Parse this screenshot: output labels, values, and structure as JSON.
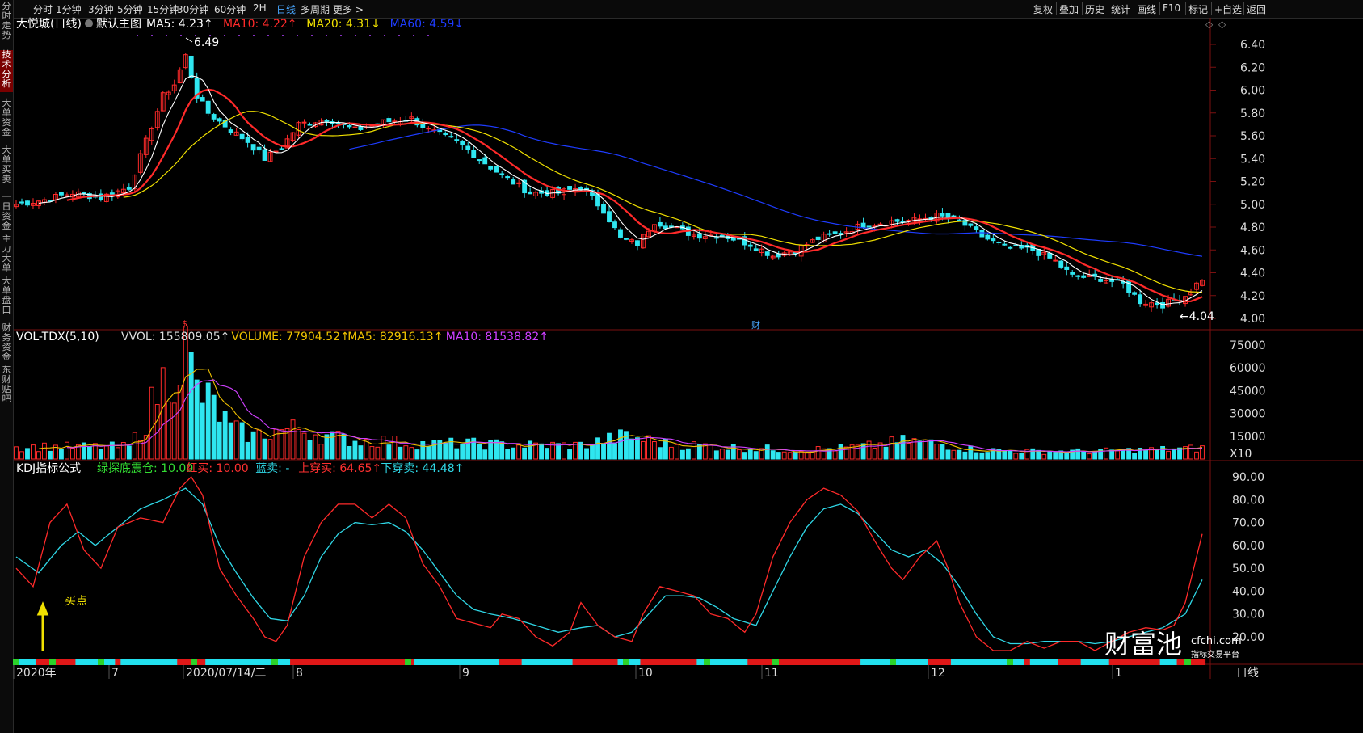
{
  "left_rail": [
    {
      "label": "分时走势",
      "active": false
    },
    {
      "label": "技术分析",
      "active": true
    },
    {
      "label": "大单资金",
      "active": false
    },
    {
      "label": "大单买卖",
      "active": false
    },
    {
      "label": "一日资金",
      "active": false
    },
    {
      "label": "主力大单",
      "active": false
    },
    {
      "label": "大单盘口",
      "active": false
    },
    {
      "label": "财务资金",
      "active": false
    },
    {
      "label": "东财贴吧",
      "active": false
    }
  ],
  "toolbar": {
    "periods": [
      "分时",
      "1分钟",
      "3分钟",
      "5分钟",
      "15分钟",
      "30分钟",
      "60分钟",
      "2H",
      "日线",
      "多周期",
      "更多 >"
    ],
    "active_period": "日线",
    "tools": [
      "复权",
      "叠加",
      "历史",
      "统计",
      "画线",
      "F10",
      "标记",
      "+自选",
      "返回"
    ]
  },
  "main_panel": {
    "stock_name": "大悦城(日线)",
    "template": "默认主图",
    "indicators": [
      {
        "label": "MA5: 4.23↑",
        "color": "#ffffff"
      },
      {
        "label": "MA10: 4.22↑",
        "color": "#ff2a2a"
      },
      {
        "label": "MA20: 4.31↓",
        "color": "#f0e000"
      },
      {
        "label": "MA60: 4.59↓",
        "color": "#1e3cff"
      }
    ],
    "price_ticks": [
      "6.40",
      "6.20",
      "6.00",
      "5.80",
      "5.60",
      "5.40",
      "5.20",
      "5.00",
      "4.80",
      "4.60",
      "4.40",
      "4.20",
      "4.00"
    ],
    "high_label": "6.49",
    "low_label": "4.04",
    "markers": [
      "$",
      "财"
    ]
  },
  "vol_panel": {
    "title": "VOL-TDX(5,10)",
    "indicators": [
      {
        "label": "VVOL: 155809.05↑",
        "color": "#dddddd"
      },
      {
        "label": "VOLUME: 77904.52↑",
        "color": "#f0c000"
      },
      {
        "label": "MA5: 82916.13↑",
        "color": "#f0c000"
      },
      {
        "label": "MA10: 81538.82↑",
        "color": "#d040ff"
      }
    ],
    "ticks": [
      "75000",
      "60000",
      "45000",
      "30000",
      "15000"
    ],
    "unit": "X10"
  },
  "kdj_panel": {
    "title": "KDJ指标公式",
    "indicators": [
      {
        "label": "绿探底震仓: 10.00",
        "color": "#33dd33"
      },
      {
        "label": "红买: 10.00",
        "color": "#ff3030"
      },
      {
        "label": "蓝卖: -",
        "color": "#2fd7e6"
      },
      {
        "label": "上穿买: 64.65↑",
        "color": "#ff3030"
      },
      {
        "label": "下穿卖: 44.48↑",
        "color": "#2fd7e6"
      }
    ],
    "ticks": [
      "90.00",
      "80.00",
      "70.00",
      "60.00",
      "50.00",
      "40.00",
      "30.00",
      "20.00"
    ],
    "buy_label": "买点"
  },
  "x_axis": {
    "labels": [
      "2020年",
      "7",
      "2020/07/14/二",
      "8",
      "9",
      "10",
      "11",
      "12",
      "1"
    ],
    "period_label": "日线"
  },
  "watermark": {
    "brand": "财富池",
    "site": "cfchi.com",
    "slogan": "指标交易平台"
  },
  "colors": {
    "up": "#ff2a2a",
    "down": "#2fe6f0",
    "ma5": "#ffffff",
    "ma10": "#ff2a2a",
    "ma20": "#f0e000",
    "ma60": "#1e3cff",
    "k": "#ff2a2a",
    "d": "#2fd7e6"
  },
  "chart_data": {
    "type": "candlestick",
    "title": "大悦城(日线)",
    "ylim": [
      4.0,
      6.5
    ],
    "x_months": [
      "2020年",
      "7",
      "8",
      "9",
      "10",
      "11",
      "12",
      "1"
    ],
    "anchor_close": [
      [
        0,
        5.0
      ],
      [
        5,
        5.04
      ],
      [
        10,
        5.1
      ],
      [
        15,
        5.06
      ],
      [
        20,
        5.15
      ],
      [
        23,
        5.55
      ],
      [
        26,
        5.95
      ],
      [
        28,
        6.05
      ],
      [
        30,
        6.3
      ],
      [
        32,
        5.95
      ],
      [
        34,
        5.8
      ],
      [
        38,
        5.65
      ],
      [
        41,
        5.55
      ],
      [
        44,
        5.4
      ],
      [
        47,
        5.5
      ],
      [
        50,
        5.7
      ],
      [
        55,
        5.75
      ],
      [
        60,
        5.65
      ],
      [
        65,
        5.72
      ],
      [
        70,
        5.75
      ],
      [
        73,
        5.65
      ],
      [
        78,
        5.55
      ],
      [
        82,
        5.4
      ],
      [
        86,
        5.25
      ],
      [
        91,
        5.1
      ],
      [
        96,
        5.1
      ],
      [
        100,
        5.15
      ],
      [
        104,
        4.95
      ],
      [
        107,
        4.7
      ],
      [
        110,
        4.65
      ],
      [
        113,
        4.85
      ],
      [
        116,
        4.8
      ],
      [
        120,
        4.73
      ],
      [
        125,
        4.73
      ],
      [
        130,
        4.65
      ],
      [
        134,
        4.55
      ],
      [
        138,
        4.6
      ],
      [
        142,
        4.7
      ],
      [
        146,
        4.75
      ],
      [
        150,
        4.82
      ],
      [
        155,
        4.85
      ],
      [
        159,
        4.86
      ],
      [
        163,
        4.9
      ],
      [
        167,
        4.85
      ],
      [
        171,
        4.72
      ],
      [
        175,
        4.62
      ],
      [
        180,
        4.6
      ],
      [
        184,
        4.5
      ],
      [
        187,
        4.37
      ],
      [
        192,
        4.35
      ],
      [
        196,
        4.3
      ],
      [
        199,
        4.15
      ],
      [
        203,
        4.12
      ],
      [
        207,
        4.2
      ],
      [
        210,
        4.35
      ]
    ],
    "volume_k": [
      [
        0,
        8
      ],
      [
        10,
        8
      ],
      [
        20,
        8
      ],
      [
        23,
        25
      ],
      [
        25,
        45
      ],
      [
        28,
        60
      ],
      [
        30,
        72
      ],
      [
        32,
        45
      ],
      [
        35,
        35
      ],
      [
        38,
        20
      ],
      [
        42,
        15
      ],
      [
        45,
        18
      ],
      [
        50,
        20
      ],
      [
        55,
        15
      ],
      [
        60,
        12
      ],
      [
        65,
        12
      ],
      [
        70,
        10
      ],
      [
        80,
        10
      ],
      [
        90,
        9
      ],
      [
        100,
        9
      ],
      [
        104,
        12
      ],
      [
        108,
        15
      ],
      [
        115,
        10
      ],
      [
        130,
        7
      ],
      [
        140,
        6
      ],
      [
        150,
        8
      ],
      [
        158,
        12
      ],
      [
        163,
        10
      ],
      [
        170,
        6
      ],
      [
        180,
        5
      ],
      [
        190,
        5
      ],
      [
        200,
        6
      ],
      [
        210,
        7
      ]
    ],
    "kdj_k": [
      [
        0,
        50
      ],
      [
        3,
        42
      ],
      [
        6,
        70
      ],
      [
        9,
        78
      ],
      [
        12,
        58
      ],
      [
        15,
        50
      ],
      [
        18,
        68
      ],
      [
        22,
        72
      ],
      [
        26,
        70
      ],
      [
        29,
        85
      ],
      [
        31,
        90
      ],
      [
        33,
        82
      ],
      [
        36,
        50
      ],
      [
        39,
        38
      ],
      [
        42,
        28
      ],
      [
        44,
        20
      ],
      [
        46,
        18
      ],
      [
        48,
        25
      ],
      [
        51,
        55
      ],
      [
        54,
        70
      ],
      [
        57,
        78
      ],
      [
        60,
        78
      ],
      [
        63,
        72
      ],
      [
        66,
        78
      ],
      [
        69,
        72
      ],
      [
        72,
        52
      ],
      [
        75,
        42
      ],
      [
        78,
        28
      ],
      [
        81,
        26
      ],
      [
        84,
        24
      ],
      [
        86,
        30
      ],
      [
        89,
        28
      ],
      [
        92,
        20
      ],
      [
        95,
        16
      ],
      [
        98,
        22
      ],
      [
        100,
        35
      ],
      [
        103,
        25
      ],
      [
        106,
        20
      ],
      [
        109,
        18
      ],
      [
        111,
        30
      ],
      [
        114,
        42
      ],
      [
        117,
        40
      ],
      [
        120,
        38
      ],
      [
        123,
        30
      ],
      [
        126,
        28
      ],
      [
        129,
        22
      ],
      [
        131,
        30
      ],
      [
        134,
        55
      ],
      [
        137,
        70
      ],
      [
        140,
        80
      ],
      [
        143,
        85
      ],
      [
        146,
        82
      ],
      [
        149,
        75
      ],
      [
        152,
        62
      ],
      [
        155,
        50
      ],
      [
        157,
        45
      ],
      [
        160,
        55
      ],
      [
        163,
        62
      ],
      [
        165,
        50
      ],
      [
        167,
        35
      ],
      [
        170,
        20
      ],
      [
        173,
        14
      ],
      [
        176,
        14
      ],
      [
        179,
        18
      ],
      [
        182,
        15
      ],
      [
        185,
        18
      ],
      [
        188,
        18
      ],
      [
        191,
        14
      ],
      [
        194,
        18
      ],
      [
        197,
        22
      ],
      [
        200,
        24
      ],
      [
        203,
        23
      ],
      [
        205,
        25
      ],
      [
        207,
        35
      ],
      [
        210,
        65
      ]
    ],
    "kdj_d": [
      [
        0,
        55
      ],
      [
        4,
        48
      ],
      [
        8,
        60
      ],
      [
        11,
        66
      ],
      [
        14,
        60
      ],
      [
        18,
        68
      ],
      [
        22,
        76
      ],
      [
        26,
        80
      ],
      [
        30,
        85
      ],
      [
        33,
        78
      ],
      [
        36,
        60
      ],
      [
        39,
        48
      ],
      [
        42,
        37
      ],
      [
        45,
        28
      ],
      [
        48,
        27
      ],
      [
        51,
        38
      ],
      [
        54,
        55
      ],
      [
        57,
        65
      ],
      [
        60,
        70
      ],
      [
        63,
        69
      ],
      [
        66,
        70
      ],
      [
        69,
        66
      ],
      [
        72,
        58
      ],
      [
        75,
        48
      ],
      [
        78,
        38
      ],
      [
        81,
        32
      ],
      [
        84,
        30
      ],
      [
        88,
        28
      ],
      [
        92,
        25
      ],
      [
        96,
        22
      ],
      [
        100,
        24
      ],
      [
        103,
        25
      ],
      [
        106,
        20
      ],
      [
        109,
        22
      ],
      [
        112,
        30
      ],
      [
        115,
        38
      ],
      [
        118,
        38
      ],
      [
        121,
        37
      ],
      [
        124,
        33
      ],
      [
        127,
        28
      ],
      [
        131,
        25
      ],
      [
        134,
        40
      ],
      [
        137,
        55
      ],
      [
        140,
        68
      ],
      [
        143,
        76
      ],
      [
        146,
        78
      ],
      [
        149,
        74
      ],
      [
        152,
        66
      ],
      [
        155,
        58
      ],
      [
        158,
        55
      ],
      [
        161,
        58
      ],
      [
        164,
        52
      ],
      [
        167,
        42
      ],
      [
        170,
        30
      ],
      [
        173,
        20
      ],
      [
        176,
        17
      ],
      [
        179,
        17
      ],
      [
        182,
        18
      ],
      [
        185,
        18
      ],
      [
        188,
        18
      ],
      [
        191,
        17
      ],
      [
        194,
        18
      ],
      [
        197,
        20
      ],
      [
        200,
        22
      ],
      [
        203,
        24
      ],
      [
        207,
        30
      ],
      [
        210,
        45
      ]
    ]
  }
}
